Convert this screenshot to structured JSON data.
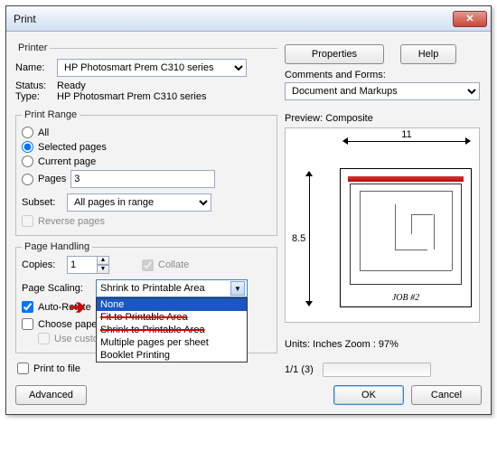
{
  "title": "Print",
  "printer": {
    "section_label": "Printer",
    "name_label": "Name:",
    "name_value": "HP Photosmart Prem C310 series",
    "status_label": "Status:",
    "status_value": "Ready",
    "type_label": "Type:",
    "type_value": "HP Photosmart Prem C310 series",
    "properties_btn": "Properties",
    "help_btn": "Help",
    "comments_label": "Comments and Forms:",
    "comments_value": "Document and Markups"
  },
  "range": {
    "legend": "Print Range",
    "all": "All",
    "selected": "Selected pages",
    "current": "Current page",
    "pages_label": "Pages",
    "pages_value": "3",
    "subset_label": "Subset:",
    "subset_value": "All pages in range",
    "reverse": "Reverse pages"
  },
  "handling": {
    "legend": "Page Handling",
    "copies_label": "Copies:",
    "copies_value": "1",
    "collate": "Collate",
    "scaling_label": "Page Scaling:",
    "scaling_value": "Shrink to Printable Area",
    "options": {
      "none": "None",
      "fit": "Fit to Printable Area",
      "shrink": "Shrink to Printable Area",
      "multi": "Multiple pages per sheet",
      "booklet": "Booklet Printing"
    },
    "autorotate": "Auto-Rotate",
    "choose_paper": "Choose pape",
    "custom_paper": "Use custom paper size when needed"
  },
  "print_to_file": "Print to file",
  "preview": {
    "label": "Preview: Composite",
    "width": "11",
    "height": "8.5",
    "job": "JOB #2",
    "units": "Units: Inches Zoom :  97%",
    "page_pos": "1/1 (3)"
  },
  "buttons": {
    "advanced": "Advanced",
    "ok": "OK",
    "cancel": "Cancel"
  }
}
